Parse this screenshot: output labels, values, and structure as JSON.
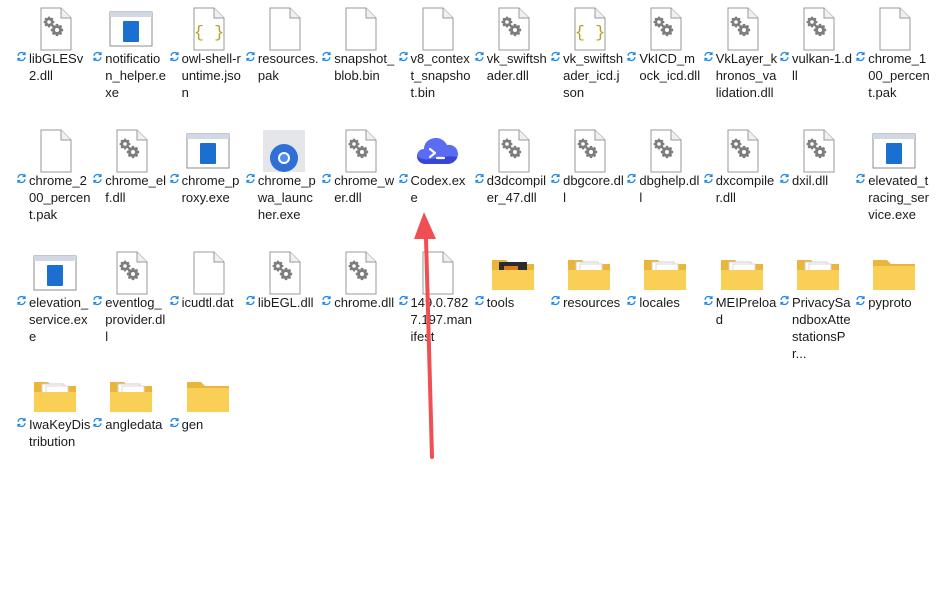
{
  "files": [
    {
      "label": "libGLESv2.dll",
      "icon": "dll-gear-icon"
    },
    {
      "label": "notification_helper.exe",
      "icon": "exe-window-icon"
    },
    {
      "label": "owl-shell-runtime.json",
      "icon": "json-braces-icon"
    },
    {
      "label": "resources.pak",
      "icon": "blank-file-icon"
    },
    {
      "label": "snapshot_blob.bin",
      "icon": "blank-file-icon"
    },
    {
      "label": "v8_context_snapshot.bin",
      "icon": "blank-file-icon"
    },
    {
      "label": "vk_swiftshader.dll",
      "icon": "dll-gear-icon"
    },
    {
      "label": "vk_swiftshader_icd.json",
      "icon": "json-braces-icon"
    },
    {
      "label": "VkICD_mock_icd.dll",
      "icon": "dll-gear-icon"
    },
    {
      "label": "VkLayer_khronos_validation.dll",
      "icon": "dll-gear-icon"
    },
    {
      "label": "vulkan-1.dll",
      "icon": "dll-gear-icon"
    },
    {
      "label": "chrome_100_percent.pak",
      "icon": "blank-file-icon"
    },
    {
      "label": "chrome_200_percent.pak",
      "icon": "blank-file-icon"
    },
    {
      "label": "chrome_elf.dll",
      "icon": "dll-gear-icon"
    },
    {
      "label": "chrome_proxy.exe",
      "icon": "exe-window-icon"
    },
    {
      "label": "chrome_pwa_launcher.exe",
      "icon": "chrome-launcher-icon"
    },
    {
      "label": "chrome_wer.dll",
      "icon": "dll-gear-icon"
    },
    {
      "label": "Codex.exe",
      "icon": "codex-cloud-icon"
    },
    {
      "label": "d3dcompiler_47.dll",
      "icon": "dll-gear-icon"
    },
    {
      "label": "dbgcore.dll",
      "icon": "dll-gear-icon"
    },
    {
      "label": "dbghelp.dll",
      "icon": "dll-gear-icon"
    },
    {
      "label": "dxcompiler.dll",
      "icon": "dll-gear-icon"
    },
    {
      "label": "dxil.dll",
      "icon": "dll-gear-icon"
    },
    {
      "label": "elevated_tracing_service.exe",
      "icon": "exe-window-icon"
    },
    {
      "label": "elevation_service.exe",
      "icon": "exe-window-icon"
    },
    {
      "label": "eventlog_provider.dll",
      "icon": "dll-gear-icon"
    },
    {
      "label": "icudtl.dat",
      "icon": "blank-file-icon"
    },
    {
      "label": "libEGL.dll",
      "icon": "dll-gear-icon"
    },
    {
      "label": "chrome.dll",
      "icon": "dll-gear-icon"
    },
    {
      "label": "149.0.7827.197.manifest",
      "icon": "blank-file-icon"
    },
    {
      "label": "tools",
      "icon": "folder-tools-icon"
    },
    {
      "label": "resources",
      "icon": "folder-docs-icon"
    },
    {
      "label": "locales",
      "icon": "folder-docs-icon"
    },
    {
      "label": "MEIPreload",
      "icon": "folder-docs-icon"
    },
    {
      "label": "PrivacySandboxAttestationsPr...",
      "icon": "folder-docs-icon"
    },
    {
      "label": "pyproto",
      "icon": "folder-empty-icon"
    },
    {
      "label": "IwaKeyDistribution",
      "icon": "folder-docs-icon"
    },
    {
      "label": "angledata",
      "icon": "folder-docs-icon"
    },
    {
      "label": "gen",
      "icon": "folder-empty-icon"
    }
  ],
  "colors": {
    "sync": "#1e88e5",
    "folder": "#f9cf55",
    "folder_back": "#e9b53a",
    "arrow": "#ef4f52",
    "codex_a": "#5b6cf4",
    "codex_b": "#3a45d6"
  }
}
